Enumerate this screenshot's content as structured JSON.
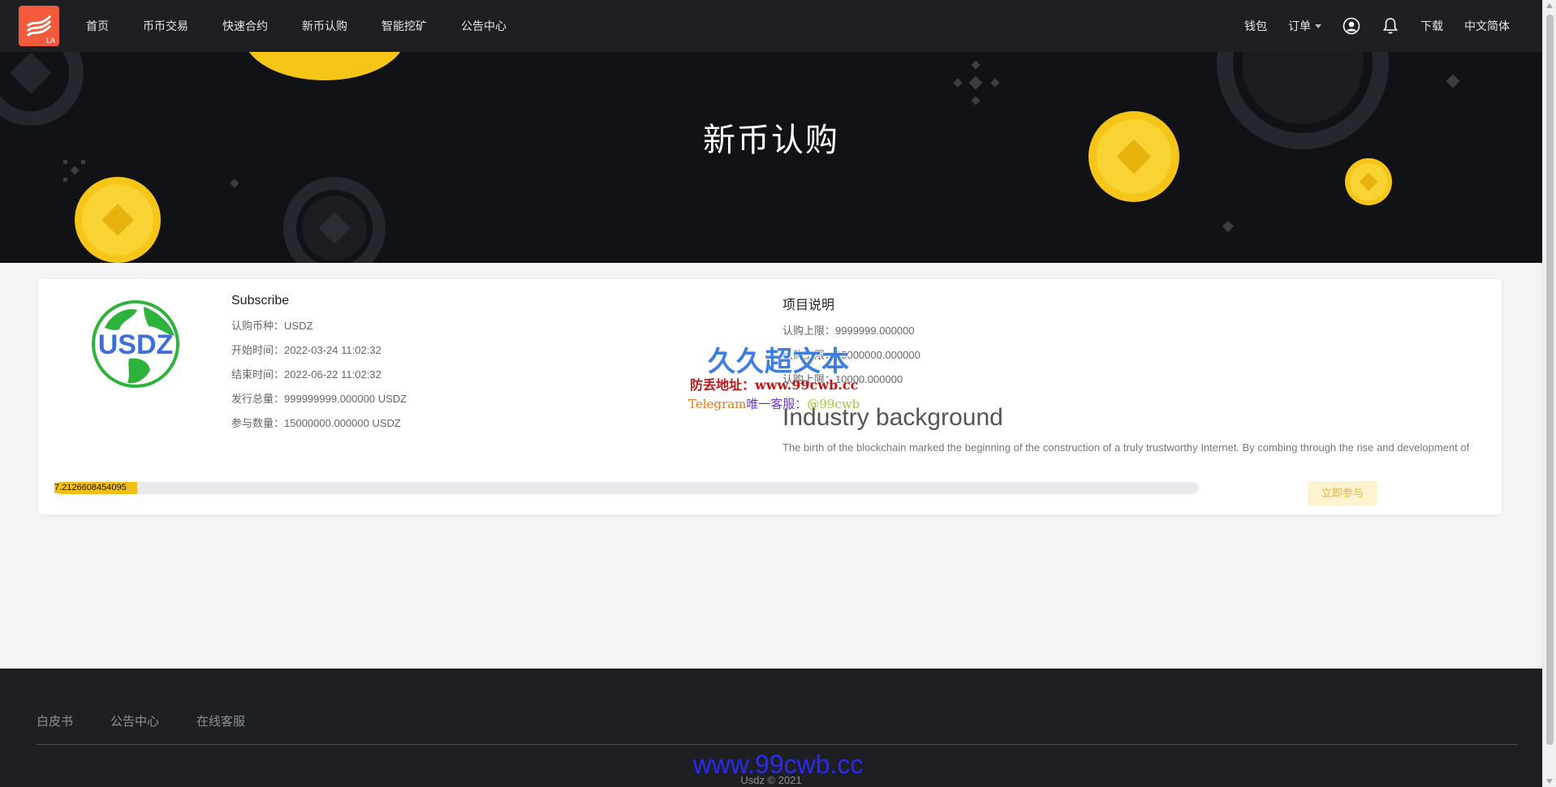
{
  "header": {
    "logo_sub": "LA",
    "nav": [
      "首页",
      "币币交易",
      "快速合约",
      "新币认购",
      "智能挖矿",
      "公告中心"
    ],
    "wallet": "钱包",
    "orders": "订单",
    "download": "下载",
    "language": "中文简体"
  },
  "banner": {
    "title": "新币认购"
  },
  "card": {
    "coin_logo_text": "USDZ",
    "subscribe": {
      "heading": "Subscribe",
      "currency_label": "认购币种：",
      "currency": "USDZ",
      "start_label": "开始时间：",
      "start": "2022-03-24 11:02:32",
      "end_label": "结束时间：",
      "end": "2022-06-22 11:02:32",
      "total_label": "发行总量：",
      "total": "999999999.000000 USDZ",
      "joined_label": "参与数量：",
      "joined": "15000000.000000 USDZ"
    },
    "project": {
      "heading": "项目说明",
      "limit_label": "认购上限：",
      "limit": "9999999.000000",
      "row2_label": "认购上限：",
      "row2": "15000000.000000",
      "row3_label": "认购上限：",
      "row3": "10000.000000",
      "industry_title": "Industry background",
      "industry_text": "The birth of the blockchain marked the beginning of the construction of a truly trustworthy Internet. By combing through the rise and development of"
    },
    "progress": {
      "percent": 7.2126608454095,
      "label": "7.2126608454095"
    },
    "join_button": "立即参与"
  },
  "watermark": {
    "title": "久久超文本",
    "address": "防丢地址：www.99cwb.cc",
    "tg_a": "Telegram",
    "tg_b": "唯一客服：",
    "tg_c": "@99cwb",
    "url": "www.99cwb.cc"
  },
  "footer": {
    "links": [
      "白皮书",
      "公告中心",
      "在线客服"
    ],
    "copyright": "Usdz © 2021"
  },
  "colors": {
    "accent": "#f2c014",
    "brand": "#f25a3c",
    "dark": "#1d1f23",
    "banner": "#101216"
  }
}
